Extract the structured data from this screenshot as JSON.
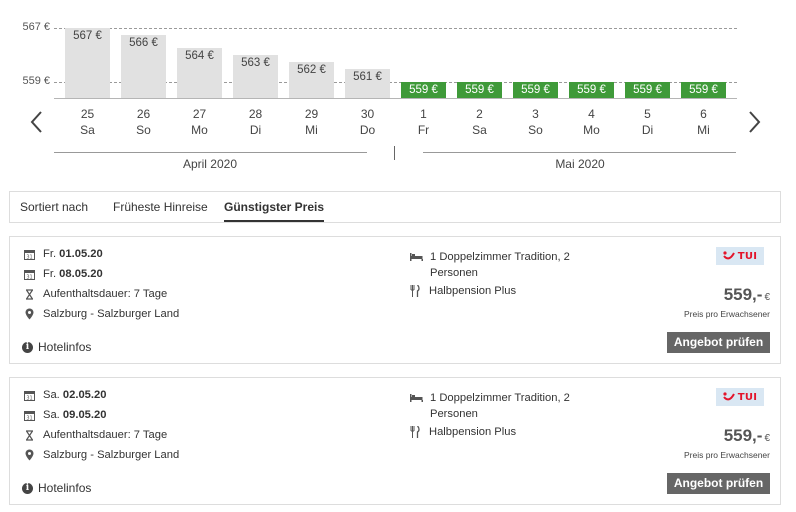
{
  "calendar": {
    "axis_labels": [
      "567 €",
      "559 €"
    ],
    "axis_values": [
      567,
      559
    ],
    "bars": [
      {
        "day": "25",
        "weekday": "Sa",
        "price_label": "567 €",
        "price": 567,
        "cheapest": false
      },
      {
        "day": "26",
        "weekday": "So",
        "price_label": "566 €",
        "price": 566,
        "cheapest": false
      },
      {
        "day": "27",
        "weekday": "Mo",
        "price_label": "564 €",
        "price": 564,
        "cheapest": false
      },
      {
        "day": "28",
        "weekday": "Di",
        "price_label": "563 €",
        "price": 563,
        "cheapest": false
      },
      {
        "day": "29",
        "weekday": "Mi",
        "price_label": "562 €",
        "price": 562,
        "cheapest": false
      },
      {
        "day": "30",
        "weekday": "Do",
        "price_label": "561 €",
        "price": 561,
        "cheapest": false
      },
      {
        "day": "1",
        "weekday": "Fr",
        "price_label": "559 €",
        "price": 559,
        "cheapest": true
      },
      {
        "day": "2",
        "weekday": "Sa",
        "price_label": "559 €",
        "price": 559,
        "cheapest": true
      },
      {
        "day": "3",
        "weekday": "So",
        "price_label": "559 €",
        "price": 559,
        "cheapest": true
      },
      {
        "day": "4",
        "weekday": "Mo",
        "price_label": "559 €",
        "price": 559,
        "cheapest": true
      },
      {
        "day": "5",
        "weekday": "Di",
        "price_label": "559 €",
        "price": 559,
        "cheapest": true
      },
      {
        "day": "6",
        "weekday": "Mi",
        "price_label": "559 €",
        "price": 559,
        "cheapest": true
      }
    ],
    "months": [
      "April 2020",
      "Mai 2020"
    ],
    "colors": {
      "cheapest": "#3f9a39",
      "other": "#e1e1e1"
    },
    "prev_icon": "chevron-left-icon",
    "next_icon": "chevron-right-icon"
  },
  "sort": {
    "label": "Sortiert nach",
    "options": [
      "Früheste Hinreise",
      "Günstigster Preis"
    ],
    "active": "Günstigster Preis"
  },
  "offers": [
    {
      "departure_prefix": "Fr.",
      "departure_date": "01.05.20",
      "return_prefix": "Fr.",
      "return_date": "08.05.20",
      "duration": "Aufenthaltsdauer: 7 Tage",
      "region": "Salzburg - Salzburger Land",
      "hotelinfo": "Hotelinfos",
      "room": "1 Doppelzimmer Tradition, 2 Personen",
      "board": "Halbpension Plus",
      "operator_logo": "TUI",
      "price": "559,-",
      "currency": "€",
      "price_note": "Preis pro Erwachsener",
      "cta": "Angebot prüfen"
    },
    {
      "departure_prefix": "Sa.",
      "departure_date": "02.05.20",
      "return_prefix": "Sa.",
      "return_date": "09.05.20",
      "duration": "Aufenthaltsdauer: 7 Tage",
      "region": "Salzburg - Salzburger Land",
      "hotelinfo": "Hotelinfos",
      "room": "1 Doppelzimmer Tradition, 2 Personen",
      "board": "Halbpension Plus",
      "operator_logo": "TUI",
      "price": "559,-",
      "currency": "€",
      "price_note": "Preis pro Erwachsener",
      "cta": "Angebot prüfen"
    }
  ]
}
